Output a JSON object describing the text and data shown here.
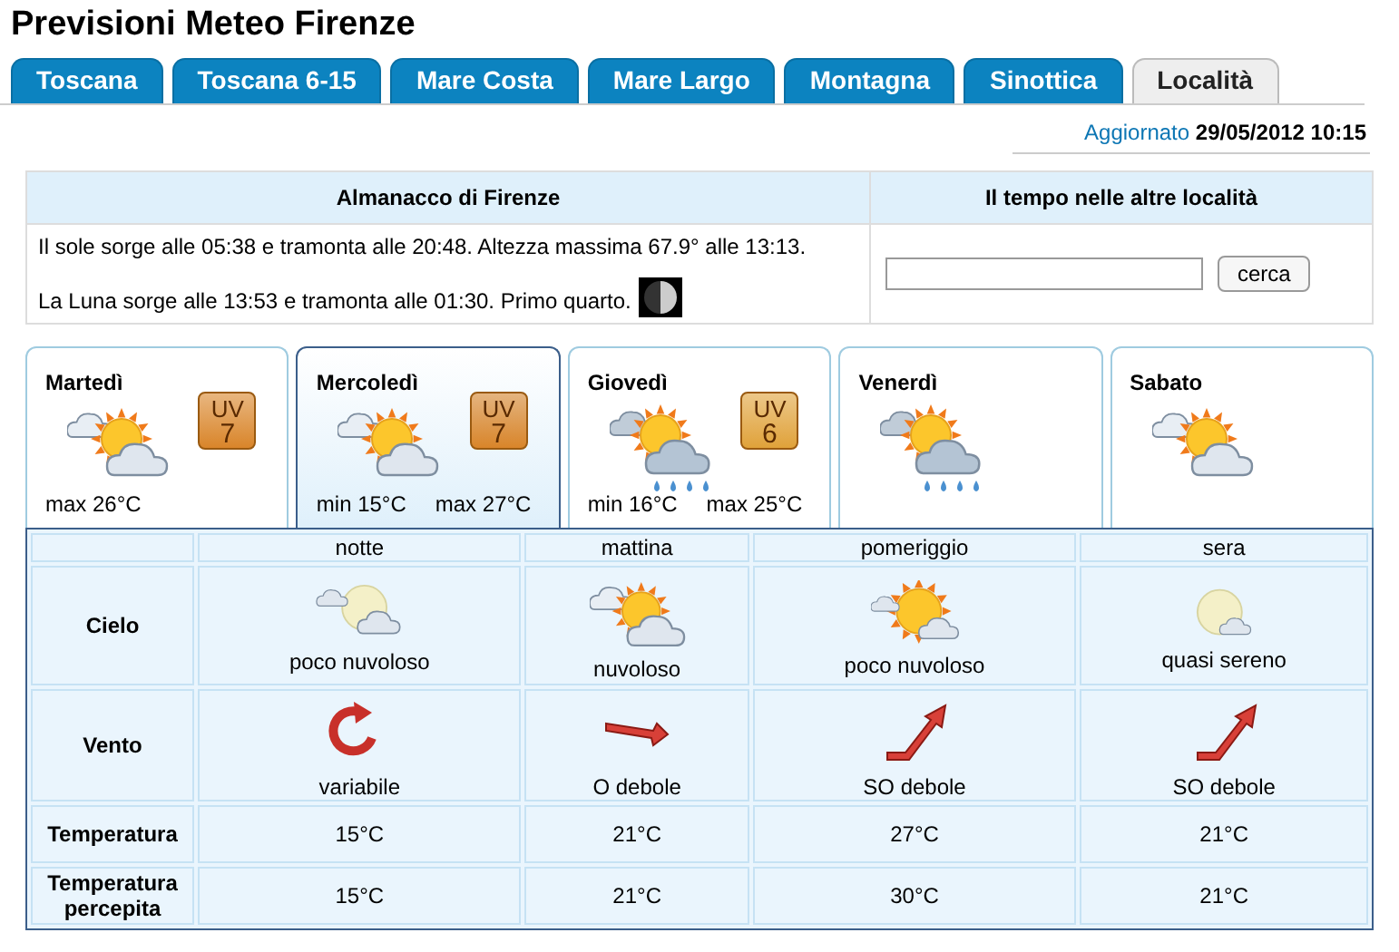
{
  "title": "Previsioni Meteo Firenze",
  "tabs": [
    {
      "label": "Toscana",
      "selected": false
    },
    {
      "label": "Toscana 6-15",
      "selected": false
    },
    {
      "label": "Mare Costa",
      "selected": false
    },
    {
      "label": "Mare Largo",
      "selected": false
    },
    {
      "label": "Montagna",
      "selected": false
    },
    {
      "label": "Sinottica",
      "selected": false
    },
    {
      "label": "Località",
      "selected": true
    }
  ],
  "updated": {
    "label": "Aggiornato",
    "value": "29/05/2012 10:15"
  },
  "almanac": {
    "title": "Almanacco di Firenze",
    "sun": "Il sole sorge alle 05:38 e tramonta alle 20:48. Altezza massima 67.9° alle 13:13.",
    "moon": "La Luna sorge alle 13:53 e tramonta alle 01:30. Primo quarto."
  },
  "search": {
    "title": "Il tempo nelle altre località",
    "button": "cerca"
  },
  "days": [
    {
      "name": "Martedì",
      "selected": false,
      "kind": "cloudy",
      "uv": {
        "label": "UV",
        "value": "7",
        "color": "#d9852a"
      },
      "temps": [
        "max 26°C"
      ]
    },
    {
      "name": "Mercoledì",
      "selected": true,
      "kind": "cloudy",
      "uv": {
        "label": "UV",
        "value": "7",
        "color": "#d9852a"
      },
      "temps": [
        "min 15°C",
        "max 27°C"
      ]
    },
    {
      "name": "Giovedì",
      "selected": false,
      "kind": "rain",
      "uv": {
        "label": "UV",
        "value": "6",
        "color": "#e0a23a"
      },
      "temps": [
        "min 16°C",
        "max 25°C"
      ]
    },
    {
      "name": "Venerdì",
      "selected": false,
      "kind": "rain"
    },
    {
      "name": "Sabato",
      "selected": false,
      "kind": "cloudy"
    }
  ],
  "detail": {
    "periods": [
      "notte",
      "mattina",
      "pomeriggio",
      "sera"
    ],
    "rows": [
      {
        "kind": "sky",
        "label": "Cielo",
        "cells": [
          {
            "kind": "moon",
            "text": "poco nuvoloso"
          },
          {
            "kind": "cloudy",
            "text": "nuvoloso"
          },
          {
            "kind": "sunny",
            "text": "poco nuvoloso"
          },
          {
            "kind": "clear",
            "text": "quasi sereno"
          }
        ]
      },
      {
        "kind": "wind",
        "label": "Vento",
        "cells": [
          {
            "kind": "variable",
            "text": "variabile"
          },
          {
            "kind": "west",
            "text": "O debole"
          },
          {
            "kind": "southwest",
            "text": "SO debole"
          },
          {
            "kind": "southwest",
            "text": "SO debole"
          }
        ]
      },
      {
        "kind": "text",
        "label": "Temperatura",
        "cells": [
          "15°C",
          "21°C",
          "27°C",
          "21°C"
        ]
      },
      {
        "kind": "text",
        "label": "Temperatura percepita",
        "cells": [
          "15°C",
          "21°C",
          "30°C",
          "21°C"
        ]
      }
    ]
  }
}
